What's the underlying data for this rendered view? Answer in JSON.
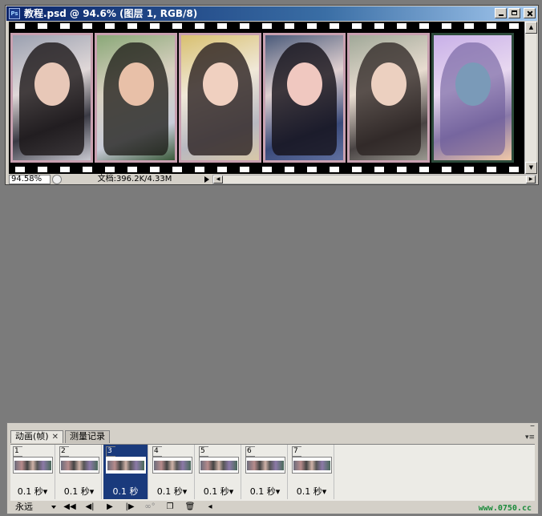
{
  "document": {
    "title": "教程.psd @ 94.6% (图层 1, RGB/8)",
    "app_icon": "Ps",
    "zoom": "94.58%",
    "doc_info": "文档:396.2K/4.33M",
    "photo_count": 6
  },
  "panel": {
    "tabs": [
      {
        "label": "动画(帧)",
        "active": true
      },
      {
        "label": "测量记录",
        "active": false
      }
    ],
    "frames": [
      {
        "number": "1",
        "delay": "0.1 秒"
      },
      {
        "number": "2",
        "delay": "0.1 秒"
      },
      {
        "number": "3",
        "delay": "0.1 秒",
        "selected": true
      },
      {
        "number": "4",
        "delay": "0.1 秒"
      },
      {
        "number": "5",
        "delay": "0.1 秒"
      },
      {
        "number": "6",
        "delay": "0.1 秒"
      },
      {
        "number": "7",
        "delay": "0.1 秒"
      }
    ],
    "loop": "永远",
    "controls": [
      "first-frame",
      "previous-frame",
      "play",
      "next-frame",
      "tween",
      "duplicate-frame",
      "delete-frame"
    ],
    "watermark": "www.0750.cc"
  },
  "colors": {
    "titlebar": "#0a246a",
    "selected_frame": "#1a3a7c",
    "workspace": "#7b7b7b"
  }
}
